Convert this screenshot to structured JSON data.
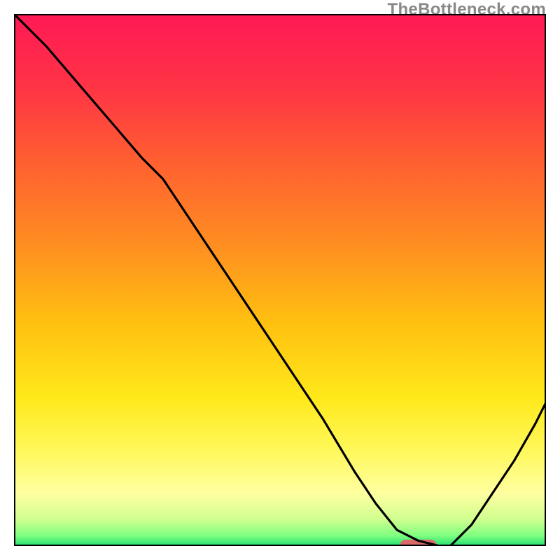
{
  "watermark": "TheBottleneck.com",
  "chart_data": {
    "type": "line",
    "title": "",
    "xlabel": "",
    "ylabel": "",
    "xlim": [
      0,
      100
    ],
    "ylim": [
      0,
      100
    ],
    "grid": false,
    "legend": false,
    "gradient_stops": [
      {
        "offset": 0.0,
        "color": "#ff1955"
      },
      {
        "offset": 0.14,
        "color": "#ff3445"
      },
      {
        "offset": 0.28,
        "color": "#ff6030"
      },
      {
        "offset": 0.44,
        "color": "#ff9020"
      },
      {
        "offset": 0.58,
        "color": "#ffc010"
      },
      {
        "offset": 0.72,
        "color": "#ffe81a"
      },
      {
        "offset": 0.82,
        "color": "#fff85a"
      },
      {
        "offset": 0.9,
        "color": "#ffffa0"
      },
      {
        "offset": 0.95,
        "color": "#d0ff90"
      },
      {
        "offset": 0.98,
        "color": "#80ff80"
      },
      {
        "offset": 1.0,
        "color": "#20e070"
      }
    ],
    "series": [
      {
        "name": "curve",
        "color": "#000000",
        "x": [
          0,
          6,
          12,
          18,
          24,
          28,
          34,
          40,
          46,
          52,
          58,
          64,
          68,
          72,
          76,
          80,
          82,
          86,
          90,
          94,
          98,
          100
        ],
        "y": [
          100,
          94,
          87,
          80,
          73,
          69,
          60,
          51,
          42,
          33,
          24,
          14,
          8,
          3,
          1,
          0,
          0,
          4,
          10,
          16,
          23,
          27
        ]
      }
    ],
    "marker": {
      "name": "optimum-marker",
      "shape": "capsule",
      "color": "#d86a6a",
      "x_center": 76,
      "y_center": 0,
      "width_x": 7,
      "height_y": 2.4
    }
  }
}
